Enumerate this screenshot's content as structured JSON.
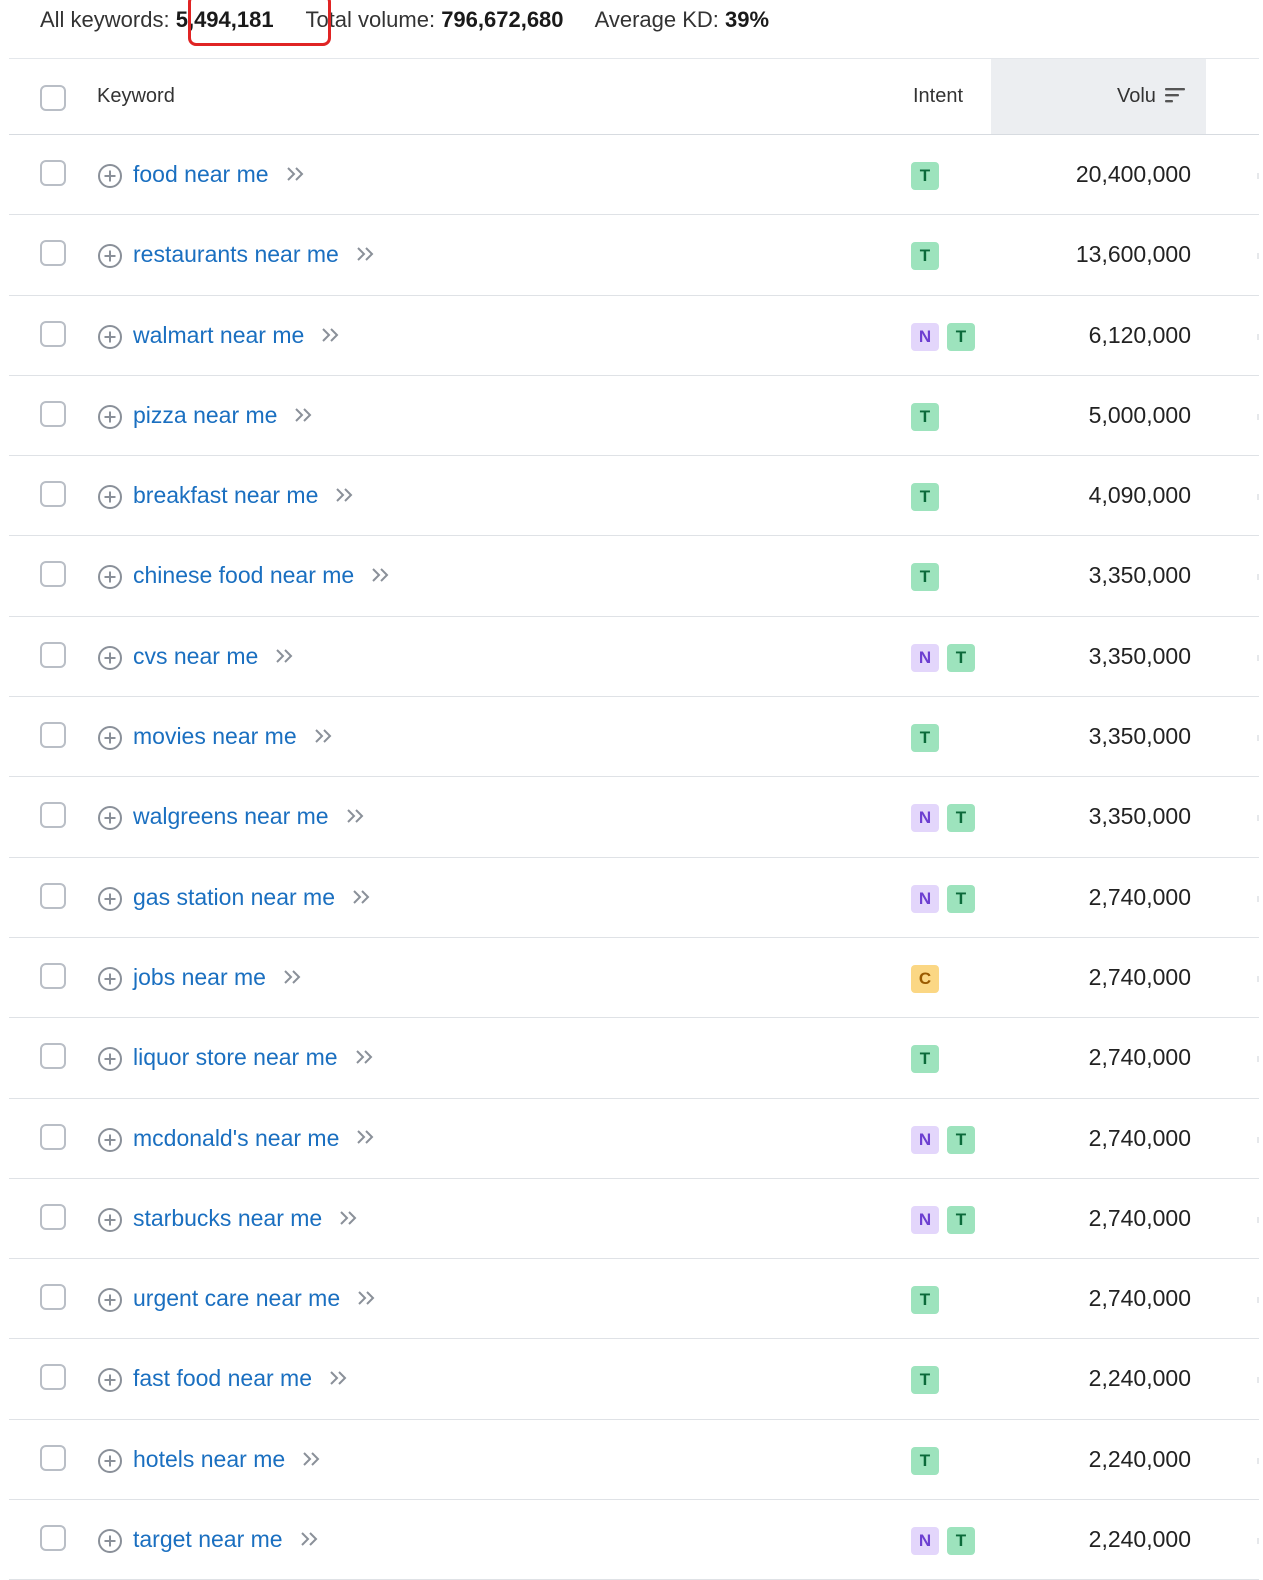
{
  "summary": {
    "all_keywords_label": "All keywords:",
    "all_keywords_value": "5,494,181",
    "total_volume_label": "Total volume:",
    "total_volume_value": "796,672,680",
    "avg_kd_label": "Average KD:",
    "avg_kd_value": "39%"
  },
  "table": {
    "headers": {
      "keyword": "Keyword",
      "intent": "Intent",
      "volume": "Volu"
    },
    "rows": [
      {
        "keyword": "food near me",
        "intents": [
          "T"
        ],
        "volume": "20,400,000"
      },
      {
        "keyword": "restaurants near me",
        "intents": [
          "T"
        ],
        "volume": "13,600,000"
      },
      {
        "keyword": "walmart near me",
        "intents": [
          "N",
          "T"
        ],
        "volume": "6,120,000"
      },
      {
        "keyword": "pizza near me",
        "intents": [
          "T"
        ],
        "volume": "5,000,000"
      },
      {
        "keyword": "breakfast near me",
        "intents": [
          "T"
        ],
        "volume": "4,090,000"
      },
      {
        "keyword": "chinese food near me",
        "intents": [
          "T"
        ],
        "volume": "3,350,000"
      },
      {
        "keyword": "cvs near me",
        "intents": [
          "N",
          "T"
        ],
        "volume": "3,350,000"
      },
      {
        "keyword": "movies near me",
        "intents": [
          "T"
        ],
        "volume": "3,350,000"
      },
      {
        "keyword": "walgreens near me",
        "intents": [
          "N",
          "T"
        ],
        "volume": "3,350,000"
      },
      {
        "keyword": "gas station near me",
        "intents": [
          "N",
          "T"
        ],
        "volume": "2,740,000"
      },
      {
        "keyword": "jobs near me",
        "intents": [
          "C"
        ],
        "volume": "2,740,000"
      },
      {
        "keyword": "liquor store near me",
        "intents": [
          "T"
        ],
        "volume": "2,740,000"
      },
      {
        "keyword": "mcdonald's near me",
        "intents": [
          "N",
          "T"
        ],
        "volume": "2,740,000"
      },
      {
        "keyword": "starbucks near me",
        "intents": [
          "N",
          "T"
        ],
        "volume": "2,740,000"
      },
      {
        "keyword": "urgent care near me",
        "intents": [
          "T"
        ],
        "volume": "2,740,000"
      },
      {
        "keyword": "fast food near me",
        "intents": [
          "T"
        ],
        "volume": "2,240,000"
      },
      {
        "keyword": "hotels near me",
        "intents": [
          "T"
        ],
        "volume": "2,240,000"
      },
      {
        "keyword": "target near me",
        "intents": [
          "N",
          "T"
        ],
        "volume": "2,240,000"
      }
    ]
  },
  "colors": {
    "link": "#1a6fc0",
    "highlight": "#e02424",
    "intent_T": "#9de3bd",
    "intent_N": "#e3d6fb",
    "intent_C": "#fbd784"
  },
  "icons": {
    "row_add": "plus-circle-icon",
    "row_expand": "double-chevron-right-icon",
    "sort": "sort-descending-icon"
  }
}
